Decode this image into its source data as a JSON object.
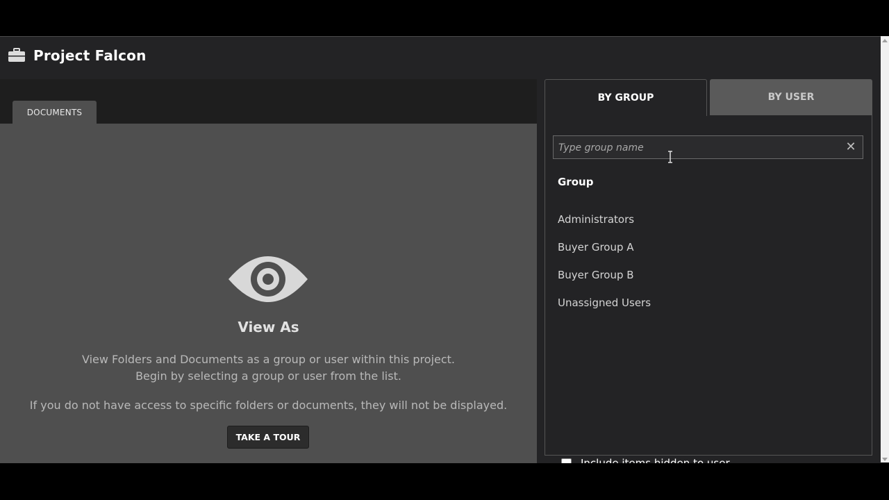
{
  "header": {
    "title": "Project Falcon",
    "icon": "briefcase-icon"
  },
  "left": {
    "tab_label": "DOCUMENTS",
    "eye_icon": "eye-icon",
    "view_title": "View As",
    "desc_line1": "View Folders and Documents as a group or user within this project.",
    "desc_line2": "Begin by selecting a group or user from the list.",
    "desc_line3": "If you do not have access to specific folders or documents, they will not be displayed.",
    "tour_button": "TAKE A TOUR"
  },
  "right": {
    "tabs": [
      {
        "label": "BY GROUP",
        "active": true
      },
      {
        "label": "BY USER",
        "active": false
      }
    ],
    "search": {
      "placeholder": "Type group name",
      "value": ""
    },
    "list_header": "Group",
    "groups": [
      "Administrators",
      "Buyer Group A",
      "Buyer Group B",
      "Unassigned Users"
    ],
    "include_hidden": {
      "label": "Include items hidden to user",
      "checked": false
    }
  },
  "colors": {
    "app_bg": "#232325",
    "content_bg": "#4f4f4f",
    "inactive_tab": "#5a5a5a"
  }
}
